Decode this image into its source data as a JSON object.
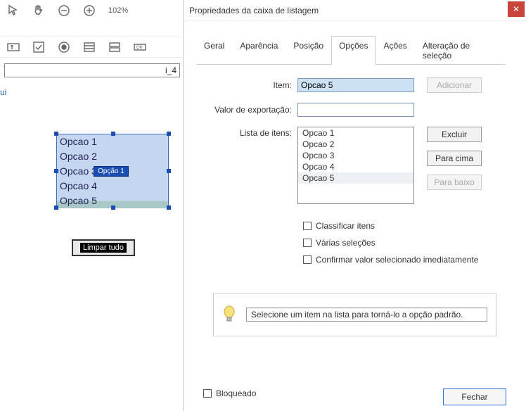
{
  "toolbar": {
    "zoom": "102%"
  },
  "field_bar": {
    "name": "i_4"
  },
  "side_text": "ui",
  "canvas_listbox": {
    "items": [
      "Opcao 1",
      "Opcao 2",
      "Opcao 3",
      "Opcao 4",
      "Opcao 5"
    ],
    "popup": "Opção 1"
  },
  "clear_button": "Limpar tudo",
  "dialog": {
    "title": "Propriedades da caixa de listagem",
    "tabs": [
      "Geral",
      "Aparência",
      "Posição",
      "Opções",
      "Ações",
      "Alteração de seleção"
    ],
    "active_tab": 3,
    "labels": {
      "item": "Item:",
      "export": "Valor de exportação:",
      "list": "Lista de itens:"
    },
    "item_value": "Opcao 5",
    "export_value": "",
    "list_items": [
      "Opcao 1",
      "Opcao 2",
      "Opcao 3",
      "Opcao 4",
      "Opcao 5"
    ],
    "selected_list_index": 4,
    "buttons": {
      "add": "Adicionar",
      "delete": "Excluir",
      "up": "Para cima",
      "down": "Para baixo",
      "close": "Fechar"
    },
    "checks": {
      "sort": "Classificar itens",
      "multi": "Várias seleções",
      "commit": "Confirmar valor selecionado imediatamente"
    },
    "hint": "Selecione um item na lista para torná-lo a opção padrão.",
    "locked": "Bloqueado"
  }
}
